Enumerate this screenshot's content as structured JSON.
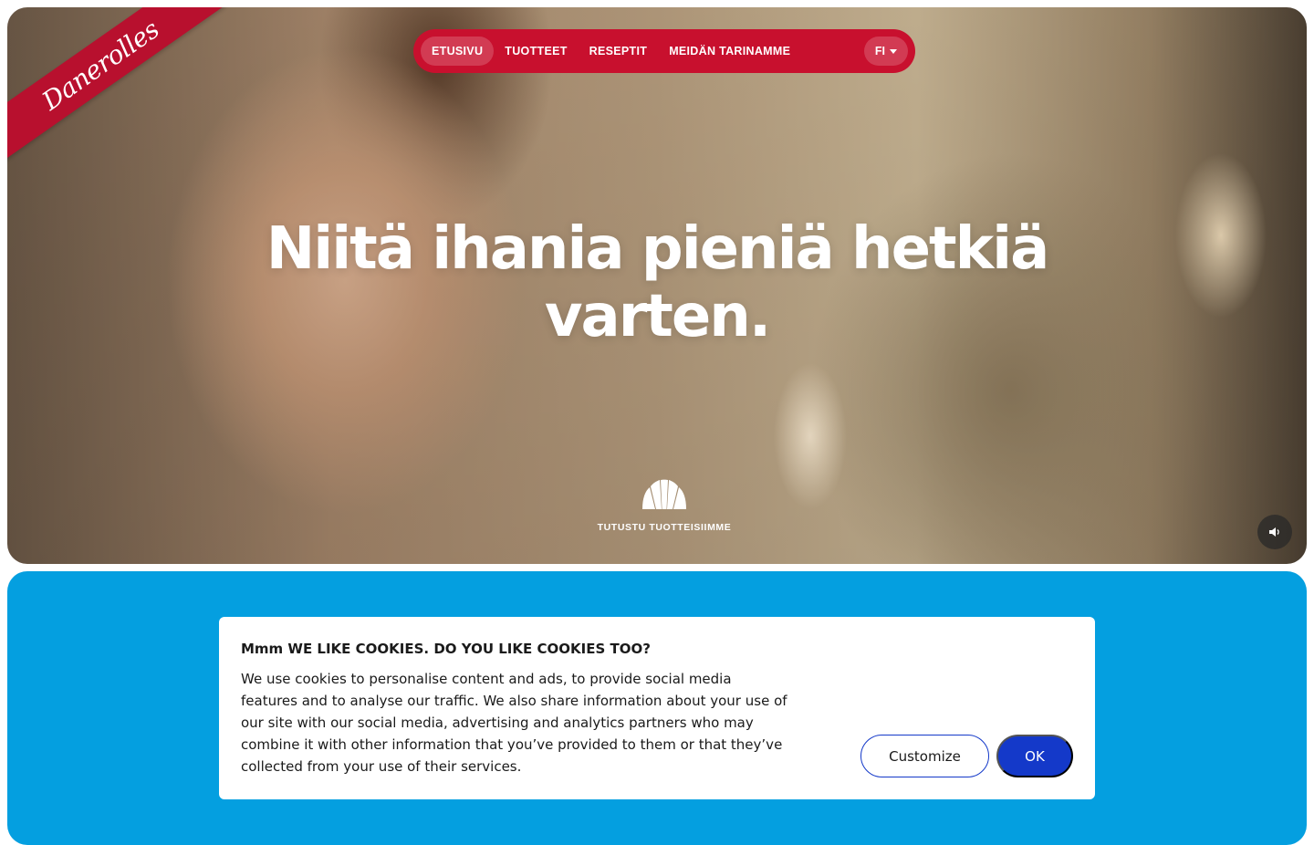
{
  "brand": {
    "logo_text": "Danerolles",
    "color": "#c8102e"
  },
  "nav": {
    "items": [
      {
        "label": "ETUSIVU",
        "active": true
      },
      {
        "label": "TUOTTEET",
        "active": false
      },
      {
        "label": "RESEPTIT",
        "active": false
      },
      {
        "label": "MEIDÄN TARINAMME",
        "active": false
      }
    ],
    "language": "FI"
  },
  "hero": {
    "headline_line1": "Niitä ihania pieniä hetkiä",
    "headline_line2": "varten.",
    "explore_label": "TUTUSTU TUOTTEISIIMME",
    "explore_icon": "croissant-icon",
    "sound_icon": "speaker-icon"
  },
  "section": {
    "color": "#049fe0"
  },
  "cookie_banner": {
    "title": "Mmm WE LIKE COOKIES. DO YOU LIKE COOKIES TOO?",
    "body": "We use cookies to personalise content and ads, to provide social media features and to analyse our traffic. We also share information about your use of our site with our social media, advertising and analytics partners who may combine it with other information that you’ve provided to them or that they’ve collected from your use of their services.",
    "customize_label": "Customize",
    "ok_label": "OK",
    "accent": "#1439c9"
  }
}
